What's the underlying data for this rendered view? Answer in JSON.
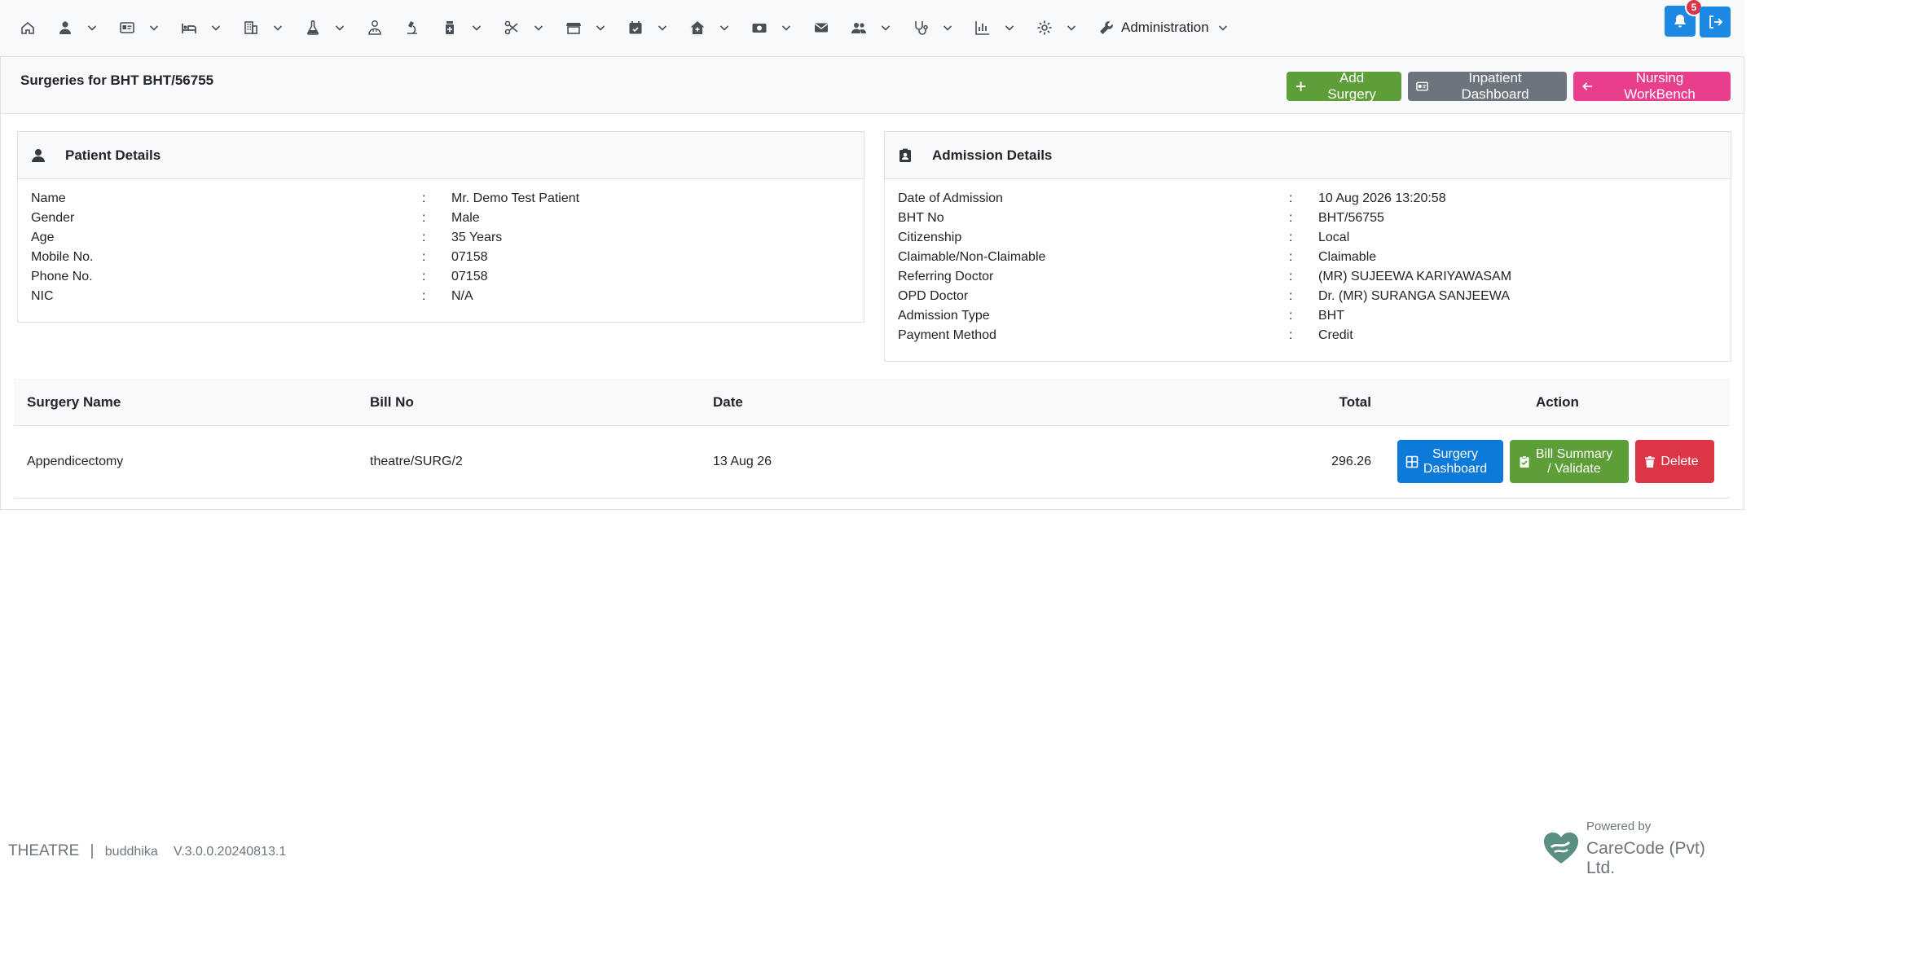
{
  "navbar": {
    "items": [
      {
        "icon": "home-icon",
        "caret": false
      },
      {
        "icon": "user-icon",
        "caret": true
      },
      {
        "icon": "id-card-icon",
        "caret": true
      },
      {
        "icon": "bed-icon",
        "caret": true
      },
      {
        "icon": "building-icon",
        "caret": true
      },
      {
        "icon": "flask-icon",
        "caret": true
      },
      {
        "icon": "doctor-icon",
        "caret": false
      },
      {
        "icon": "microscope-icon",
        "caret": false
      },
      {
        "icon": "medicine-bottle-icon",
        "caret": true
      },
      {
        "icon": "scissors-icon",
        "caret": true
      },
      {
        "icon": "store-icon",
        "caret": true
      },
      {
        "icon": "calendar-icon",
        "caret": true
      },
      {
        "icon": "house-medical-icon",
        "caret": true
      },
      {
        "icon": "money-icon",
        "caret": true
      },
      {
        "icon": "envelope-icon",
        "caret": false
      },
      {
        "icon": "users-icon",
        "caret": true
      },
      {
        "icon": "stethoscope-icon",
        "caret": true
      },
      {
        "icon": "bar-chart-icon",
        "caret": true
      },
      {
        "icon": "gear-icon",
        "caret": true
      }
    ],
    "admin_label": "Administration",
    "notification_count": "5"
  },
  "header": {
    "title": "Surgeries for BHT  BHT/56755",
    "add_surgery": "Add Surgery",
    "inpatient_dashboard": "Inpatient Dashboard",
    "nursing_workbench": "Nursing WorkBench"
  },
  "patient": {
    "title": "Patient Details",
    "rows": [
      {
        "label": "Name",
        "value": "Mr. Demo Test Patient"
      },
      {
        "label": "Gender",
        "value": "Male"
      },
      {
        "label": "Age",
        "value": "35 Years"
      },
      {
        "label": "Mobile No.",
        "value": "07158"
      },
      {
        "label": "Phone No.",
        "value": "07158"
      },
      {
        "label": "NIC",
        "value": "N/A"
      }
    ]
  },
  "admission": {
    "title": "Admission Details",
    "rows": [
      {
        "label": "Date of Admission",
        "value": "10 Aug 2026 13:20:58"
      },
      {
        "label": "BHT No",
        "value": "BHT/56755"
      },
      {
        "label": "Citizenship",
        "value": "Local"
      },
      {
        "label": "Claimable/Non-Claimable",
        "value": "Claimable"
      },
      {
        "label": "Referring Doctor",
        "value": "(MR) SUJEEWA KARIYAWASAM"
      },
      {
        "label": "OPD Doctor",
        "value": "Dr. (MR) SURANGA SANJEEWA"
      },
      {
        "label": "Admission Type",
        "value": "BHT"
      },
      {
        "label": "Payment Method",
        "value": "Credit"
      }
    ]
  },
  "colon": ":",
  "table": {
    "headers": {
      "name": "Surgery Name",
      "bill": "Bill No",
      "date": "Date",
      "total": "Total",
      "action": "Action"
    },
    "rows": [
      {
        "name": "Appendicectomy",
        "bill": "theatre/SURG/2",
        "date": "13 Aug 26",
        "total": "296.26"
      }
    ],
    "surgery_dashboard_line1": "Surgery",
    "surgery_dashboard_line2": "Dashboard",
    "bill_summary_line1": "Bill Summary",
    "bill_summary_line2": "/ Validate",
    "delete": "Delete"
  },
  "footer": {
    "module": "THEATRE",
    "separator": "|",
    "user": "buddhika",
    "version": "V.3.0.0.20240813.1",
    "powered_by": "Powered by",
    "company": "CareCode (Pvt) Ltd."
  },
  "colors": {
    "primary": "#1e88e5",
    "success": "#5d9e38",
    "secondary": "#6c757d",
    "pink": "#e83e8c",
    "danger": "#dc3545"
  }
}
